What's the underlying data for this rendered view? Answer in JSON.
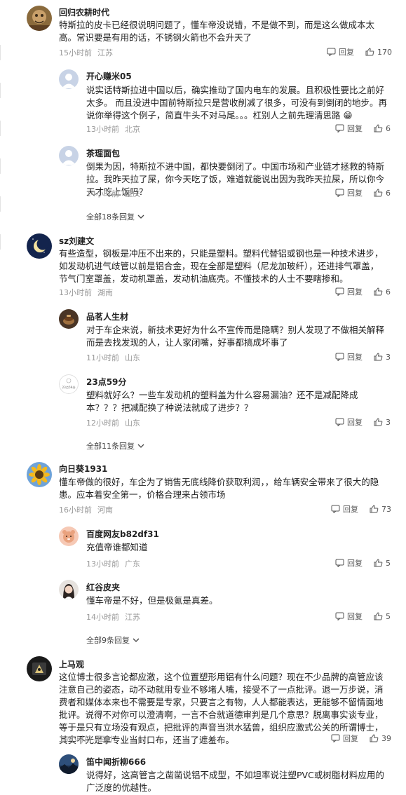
{
  "reply_label": "回复",
  "comments": [
    {
      "user": "回归农耕时代",
      "text": "特斯拉的皮卡已经很说明问题了，懂车帝没说错，不是做不到，而是这么做成本太高。常识要是有用的话，不锈钢火箭也不会升天了",
      "time": "15小时前",
      "location": "江苏",
      "likes": "170",
      "replies": [
        {
          "user": "开心赚米05",
          "text": "说实话特斯拉进中国以后，确实推动了国内电车的发展。且积极性要比之前好太多。 而且没进中国前特斯拉只是营收削减了很多，可没有到倒闭的地步。再说你举得这个例子，简直牛头不对马尾。。。杠别人之前先理清思路 😁",
          "time": "13小时前",
          "location": "北京",
          "likes": "6"
        },
        {
          "user": "茶理面包",
          "text": "倒果为因，特斯拉不进中国，都快要倒闭了。中国市场和产业链才拯救的特斯拉。我昨天拉了屎，你今天吃了饭，难道就能说出因为我昨天拉屎，所以你今天才吃上饭吗？",
          "time": "14小时前",
          "location": "重庆",
          "likes": "6"
        }
      ],
      "more": "全部18条回复"
    },
    {
      "user": "sz刘建文",
      "text": "有些造型，钢板是冲压不出来的，只能是塑料。塑料代替铝或钢也是一种技术进步，如发动机进气歧管以前是铝合金，现在全部是塑料（尼龙加玻纤），还进排气罩盖，节气门室罩盖，发动机罩盖，发动机油底壳。不懂技术的人士不要瞎掺和。",
      "time": "13小时前",
      "location": "湖南",
      "likes": "6",
      "replies": [
        {
          "user": "品茗人生材",
          "text": "对于车企来说，新技术更好为什么不宣传而是隐瞒？别人发现了不做相关解释而是去找发现的人，让人家闭嘴，好事都搞成坏事了",
          "time": "11小时前",
          "location": "山东",
          "likes": "3"
        },
        {
          "user": "23点59分",
          "avatar_text": "23点59分",
          "text": "塑料就好么？一些车发动机的塑料盖为什么容易漏油？还不是减配降成本？？？把减配换了种说法就成了进步？？",
          "time": "12小时前",
          "location": "山东",
          "likes": "3"
        }
      ],
      "more": "全部11条回复"
    },
    {
      "user": "向日葵1931",
      "text": "懂车帝做的很好，车企为了销售无底线降价获取利润，，给车辆安全带来了很大的隐患。应本着安全第一，价格合理来占领市场",
      "time": "16小时前",
      "location": "河南",
      "likes": "73",
      "replies": [
        {
          "user": "百度网友b82df31",
          "text": "充值帝谁都知道",
          "time": "13小时前",
          "location": "广东",
          "likes": "5"
        },
        {
          "user": "红谷皮夹",
          "text": "懂车帝是不好，但是极氪是真差。",
          "time": "14小时前",
          "location": "江苏",
          "likes": "5"
        }
      ],
      "more": "全部9条回复"
    },
    {
      "user": "上马观",
      "text": "这位博士很多言论都应激，这个位置塑形用铝有什么问题？现在不少品牌的高管应该注意自己的姿态，动不动就用专业不够堵人嘴，接受不了一点批评。退一万步说，消费者和媒体本来也不需要是专家，只要言之有物，人人都能表达，更能够不留情面地批评。说得不对你可以澄清啊，一言不合就道德审判是几个意思？脱离事实谈专业，等于是只有立场没有观点，把批评的声音当洪水猛兽，组织应激式公关的所谓博士，其实不光是拿专业当封口布，还当了遮羞布。",
      "time": "14小时前",
      "location": "四川",
      "likes": "39",
      "replies": [
        {
          "user": "笛中闻折柳666",
          "text": "说得好，这高管言之凿凿说铝不成型，不如坦率说注塑PVC或树脂材料应用的广泛度的优越性。"
        }
      ]
    }
  ]
}
